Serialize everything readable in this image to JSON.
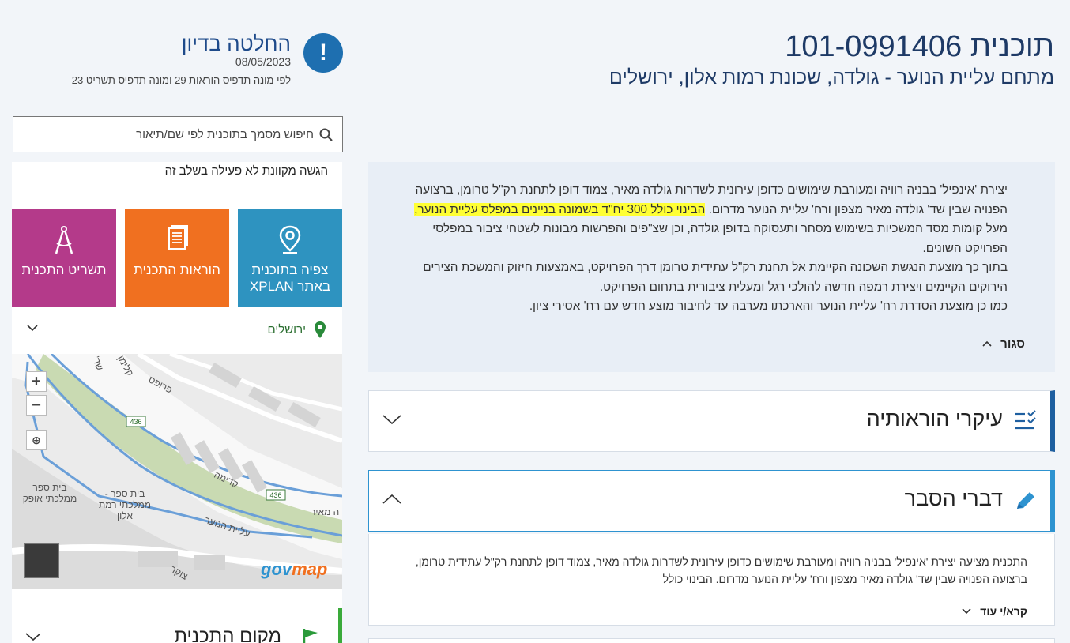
{
  "header": {
    "plan_title": "תוכנית 101-0991406",
    "plan_subtitle": "מתחם עליית הנוער - גולדה, שכונת רמות אלון, ירושלים",
    "status_icon_glyph": "!",
    "status_title": "החלטה בדיון",
    "status_date": "08/05/2023",
    "status_desc": "לפי מונה תדפיס הוראות 29 ומונה תדפיס תשריט 23"
  },
  "search": {
    "placeholder": "חיפוש מסמך בתוכנית לפי שם/תיאור",
    "value": "",
    "icon": "search-icon"
  },
  "sidebar": {
    "submission_note": "הגשה מקוונת לא פעילה בשלב זה",
    "tiles": [
      {
        "label": "צפיה בתוכנית באתר XPLAN",
        "icon": "location-pin-icon",
        "color": "#2e93c0"
      },
      {
        "label": "הוראות התכנית",
        "icon": "document-icon",
        "color": "#f07020"
      },
      {
        "label": "תשריט התכנית",
        "icon": "compass-icon",
        "color": "#b43a8a"
      }
    ],
    "location": "ירושלים",
    "map": {
      "zoom_in": "+",
      "zoom_out": "−",
      "zoom_area": "⊕",
      "logo_gov": "gov",
      "logo_map": "map",
      "labels": [
        "פרופס",
        "קדימה",
        "עליית הנוער",
        "בית ספר ממלכתי אופק",
        "בית ספר - ממלכתי רמת אלון",
        "צוקר",
        "436",
        "436",
        "ה מאיר",
        "שד'",
        "קלימן"
      ]
    },
    "plan_location_label": "מקום התכנית"
  },
  "main": {
    "description_lines": [
      "יצירת 'אינפיל' בבניה רוויה ומעורבת שימושים כדופן עירונית לשדרות גולדה מאיר, צמוד דופן לתחנת רק\"ל טרומן, ברצועה",
      "הפנויה שבין שד' גולדה מאיר מצפון ורח' עליית הנוער מדרום.",
      "הבינוי כולל 300 יח\"ד בשמונה בניינים במפלס עליית הנוער,",
      "מעל קומות מסד המשכיות בשימוש מסחר ותעסוקה בדופן גולדה, וכן שצ\"פים והפרשות מבונות לשטחי ציבור במפלסי",
      "הפרויקט השונים.",
      "בתוך כך מוצעת הנגשת השכונה הקיימת אל תחנת רק\"ל עתידית טרומן דרך הפרויקט, באמצעות חיזוק והמשכת הצירים",
      "הירוקים הקיימים ויצירת רמפה חדשה להולכי רגל ומעלית ציבורית בתחום הפרויקט.",
      "כמו כן מוצעת הסדרת רח' עליית הנוער והארכתו מערבה עד לחיבור מוצע חדש עם רח' אסירי ציון."
    ],
    "close_label": "סגור",
    "accordions": [
      {
        "title": "עיקרי הוראותיה",
        "icon": "checklist-icon"
      },
      {
        "title": "דברי הסבר",
        "icon": "pencil-icon"
      }
    ],
    "explanation_lines": [
      "התכנית מציעה יצירת 'אינפיל' בבניה רוויה ומעורבת שימושים כדופן עירונית לשדרות גולדה מאיר, צמוד דופן לתחנת רק\"ל עתידית טרומן,",
      "ברצועה הפנויה שבין שד' גולדה מאיר מצפון ורח' עליית הנוער מדרום. הבינוי כולל"
    ],
    "read_more_label": "קרא/י עוד"
  },
  "colors": {
    "title": "#1e3a66",
    "status_icon": "#1e6fb0",
    "tile_xplan": "#2e93c0",
    "tile_instructions": "#f07020",
    "tile_map": "#b43a8a",
    "highlight": "#ffff33",
    "accent_blue": "#2e93d0",
    "accent_green": "#3aaa3a"
  }
}
